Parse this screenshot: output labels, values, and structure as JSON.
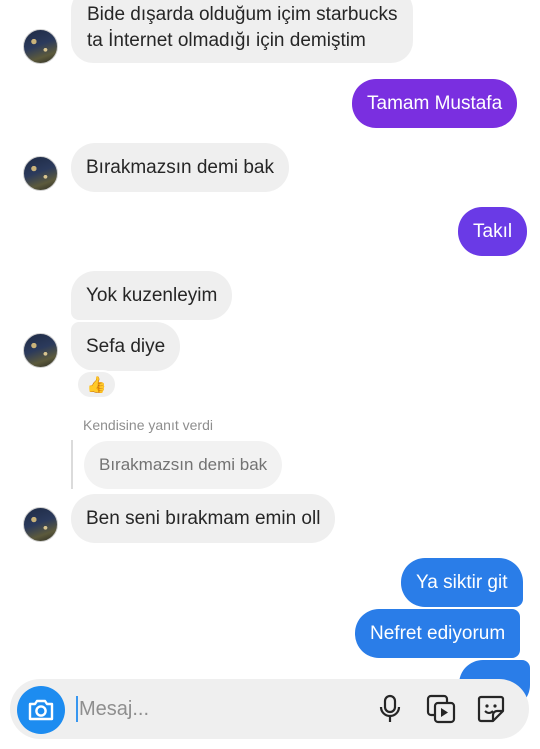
{
  "messages": [
    {
      "line1": "Bide dışarda olduğum içim starbucks",
      "line2": "ta İnternet olmadığı için demiştim"
    },
    {
      "text": "Tamam Mustafa"
    },
    {
      "text": "Bırakmazsın demi bak"
    },
    {
      "text": "Takıl"
    },
    {
      "text": "Yok kuzenleyim"
    },
    {
      "text": "Sefa diye"
    },
    {
      "reaction": "👍"
    },
    {
      "reply_meta": "Kendisine yanıt verdi",
      "quoted": "Bırakmazsın demi bak",
      "text": "Ben seni bırakmam emin oll"
    },
    {
      "text": "Ya siktir git"
    },
    {
      "text": "Nefret ediyorum"
    }
  ],
  "composer": {
    "placeholder": "Mesaj..."
  },
  "icons": [
    "camera-icon",
    "microphone-icon",
    "gallery-icon",
    "sticker-icon"
  ],
  "colors": {
    "outgoing_purple": "#7a2fe0",
    "outgoing_violet": "#6a3ae6",
    "outgoing_blue": "#2a7de8",
    "incoming": "#efefef",
    "camera_blue": "#1d8cf0"
  }
}
